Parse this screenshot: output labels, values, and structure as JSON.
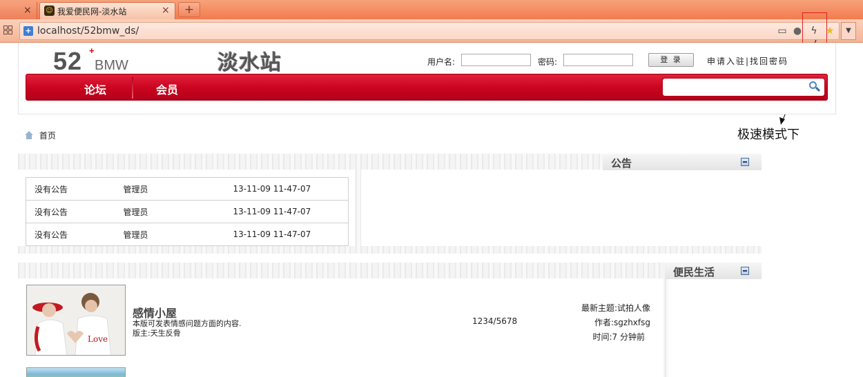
{
  "browser": {
    "prev_tab_close": "×",
    "tab_title": "我爱便民网-淡水站",
    "tab_close": "×",
    "new_tab": "+",
    "url": "localhost/52bmw_ds/"
  },
  "header": {
    "logo_num": "52",
    "logo_plus": "+",
    "logo_text": "BMW",
    "site_name": "淡水站",
    "username_label": "用户名:",
    "password_label": "密码:",
    "login_button": "登 录",
    "aux_links": "申请入驻|找回密码"
  },
  "nav": {
    "items": [
      {
        "label": "论坛"
      },
      {
        "label": "会员"
      }
    ]
  },
  "annotation": {
    "text": "极速模式下",
    "color": "#e02020"
  },
  "breadcrumb": {
    "home": "首页"
  },
  "notices": {
    "title": "公告",
    "rows": [
      {
        "text": "没有公告",
        "author": "管理员",
        "time": "13-11-09 11-47-07"
      },
      {
        "text": "没有公告",
        "author": "管理员",
        "time": "13-11-09 11-47-07"
      },
      {
        "text": "没有公告",
        "author": "管理员",
        "time": "13-11-09 11-47-07"
      }
    ]
  },
  "life": {
    "title": "便民生活"
  },
  "forums": [
    {
      "name": "感情小屋",
      "description": "本版可发表情感问题方面的内容.",
      "moderator": "版主:天生反骨",
      "counts": "1234/5678",
      "latest_topic": "最新主题:试拍人像",
      "author": "作者:sgzhxfsg",
      "time": "时间:7 分钟前"
    }
  ],
  "colors": {
    "tabbar": "#f27c4f",
    "nav_red": "#cc0520",
    "accent_blue": "#4a86c4"
  },
  "icons": {
    "apps": "grid-icon",
    "site": "shield-icon",
    "search": "magnifier-icon",
    "home": "home-icon",
    "minimize": "minus-icon"
  }
}
